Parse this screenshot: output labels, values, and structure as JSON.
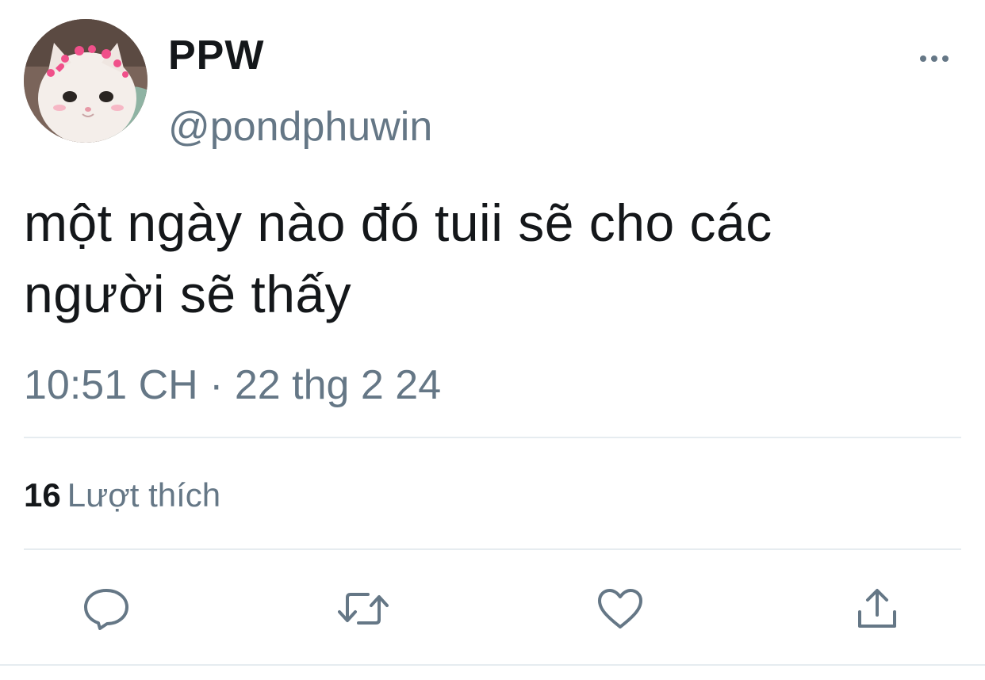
{
  "tweet": {
    "display_name": "PPW",
    "handle": "@pondphuwin",
    "text_line1": "một ngày nào đó tuii sẽ cho các",
    "text_line2": "người sẽ thấy",
    "timestamp": "10:51 CH · 22 thg 2 24",
    "likes_count": "16",
    "likes_label": "Lượt thích"
  },
  "icons": {
    "more": "more-horizontal-icon",
    "reply": "reply-icon",
    "retweet": "retweet-icon",
    "like": "heart-icon",
    "share": "share-icon"
  },
  "colors": {
    "text_primary": "#14171a",
    "text_secondary": "#657786",
    "divider": "#e6ecf0",
    "icon": "#657786"
  }
}
